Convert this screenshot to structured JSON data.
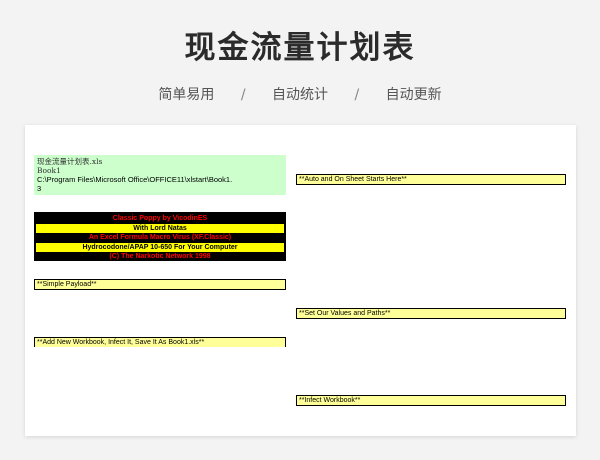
{
  "header": {
    "title": "现金流量计划表",
    "tags": [
      "简单易用",
      "自动统计",
      "自动更新"
    ],
    "separator": "/"
  },
  "sheet": {
    "file_name": "现金流量计划表.xls",
    "book": "Book1",
    "path_line1": "C:\\Program Files\\Microsoft Office\\OFFICE11\\xlstart\\Book1.",
    "path_line2": "3",
    "banner": [
      "Classic Poppy by VicodinES",
      "With Lord Natas",
      "An Excel Formula Macro Virus (XF.Classic)",
      "Hydrocodone/APAP  10-650 For Your Computer",
      "(C) The Narkotic Network 1998"
    ],
    "auto_start": "**Auto and On Sheet Starts Here**",
    "simple_payload": "**Simple Payload**",
    "set_values": "**Set Our Values and Paths**",
    "add_workbook": "**Add New Workbook, Infect It, Save It As Book1.xls**",
    "infect_workbook": "**Infect Workbook**"
  },
  "colors": {
    "background": "#f3f3f3",
    "green_cell": "#ccffcc",
    "yellow_cell": "#ffff99",
    "banner_yellow": "#ffff00",
    "banner_red": "#ff0000"
  }
}
